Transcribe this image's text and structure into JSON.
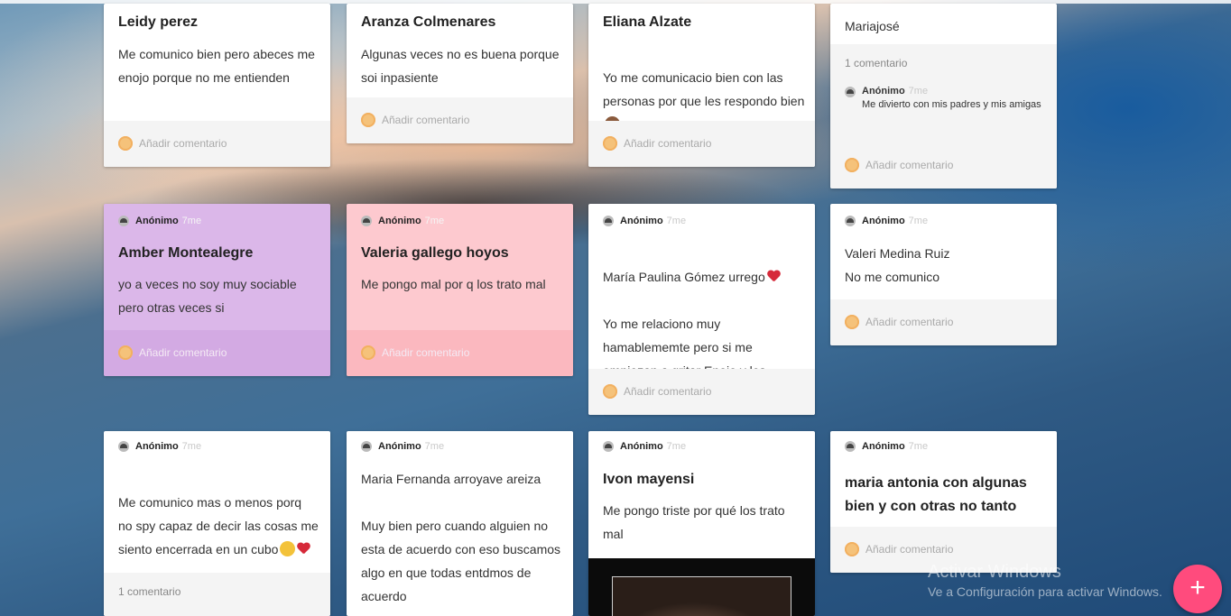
{
  "add_comment_label": "Añadir comentario",
  "author": "Anónimo",
  "time": "7me",
  "cards": {
    "c1": {
      "title": "Leidy perez",
      "body": "Me comunico bien pero abeces me enojo porque no me entienden"
    },
    "c2": {
      "title": "Aranza Colmenares",
      "body": "Algunas veces no es buena porque soi inpasiente"
    },
    "c3": {
      "title": "Eliana Alzate",
      "body": "Yo me comunicacio bien con las personas por que les respondo bien"
    },
    "c4": {
      "body": "Mariajosé",
      "comment_count": "1 comentario",
      "comment_text": "Me divierto con mis padres y mis amigas"
    },
    "c5": {
      "title": "Amber Montealegre",
      "body": "yo a veces no soy  muy sociable pero otras veces si"
    },
    "c6": {
      "title": "Valeria gallego hoyos",
      "body": "Me pongo mal por q los trato mal"
    },
    "c7": {
      "line1": "María Paulina Gómez urrego",
      "body": "Yo me relaciono muy hamablememte pero si me empiezan a gritar Enojo y les contesto grosero"
    },
    "c8": {
      "body": "Valeri Medina Ruiz\nNo me comunico"
    },
    "c9": {
      "body": "Me comunico mas o menos porq no spy capaz de decir las cosas me siento encerrada en un cubo",
      "comment_count": "1 comentario"
    },
    "c10": {
      "body": "Maria Fernanda arroyave areiza\n\nMuy bien pero cuando alguien no esta de acuerdo con eso buscamos algo en que todas entdmos de acuerdo"
    },
    "c11": {
      "title": "Ivon mayensi",
      "body": "Me pongo triste por qué los trato mal"
    },
    "c12": {
      "title": "maria antonia  con algunas bien y con otras no tanto"
    }
  },
  "watermark": {
    "line1": "Activar Windows",
    "line2": "Ve a Configuración para activar Windows."
  },
  "fab_label": "+",
  "colors": {
    "purple_card": "#dbb7e9",
    "pink_card": "#fdc9cf",
    "fab": "#ff4b7d"
  }
}
